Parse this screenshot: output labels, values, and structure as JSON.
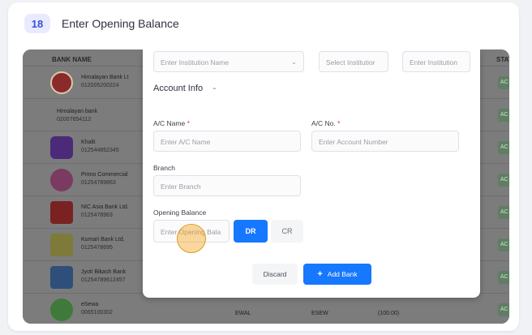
{
  "step": {
    "number": "18",
    "title": "Enter Opening Balance"
  },
  "background_table": {
    "header_left": "BANK NAME",
    "header_right": "STAT",
    "rows": [
      {
        "name": "Himalayan Bank Lt",
        "number": "012005200224",
        "status": "AC"
      },
      {
        "name": "Himalayan bank",
        "number": "02007654112",
        "status": "AC"
      },
      {
        "name": "Khalti",
        "number": "012544852345",
        "status": "AC"
      },
      {
        "name": "Primo Commercial",
        "number": "01254789863",
        "status": "AC"
      },
      {
        "name": "NIC Asia Bank Ltd.",
        "number": "0125478963",
        "status": "AC"
      },
      {
        "name": "Kumari Bank Ltd.",
        "number": "0125478695",
        "status": "AC"
      },
      {
        "name": "Jyoti Bikash Bank",
        "number": "01254789612457",
        "status": "AC"
      },
      {
        "name": "eSewa",
        "number": "0065100302",
        "status": "AC"
      }
    ],
    "bottom_cells": [
      "EWAL",
      "ESEW",
      "(100.00)"
    ]
  },
  "modal": {
    "top_placeholders": [
      "Enter Institution Name",
      "Select Institutior",
      "Enter Institution"
    ],
    "section_title": "Account Info",
    "ac_name_label": "A/C Name",
    "ac_name_placeholder": "Enter A/C Name",
    "ac_no_label": "A/C No.",
    "ac_no_placeholder": "Enter Account Number",
    "required_mark": "*",
    "branch_label": "Branch",
    "branch_placeholder": "Enter Branch",
    "opening_balance_label": "Opening Balance",
    "opening_balance_placeholder": "Enter Opening Bala",
    "dr_label": "DR",
    "cr_label": "CR",
    "discard_label": "Discard",
    "add_label": "Add Bank",
    "add_icon": "+"
  }
}
